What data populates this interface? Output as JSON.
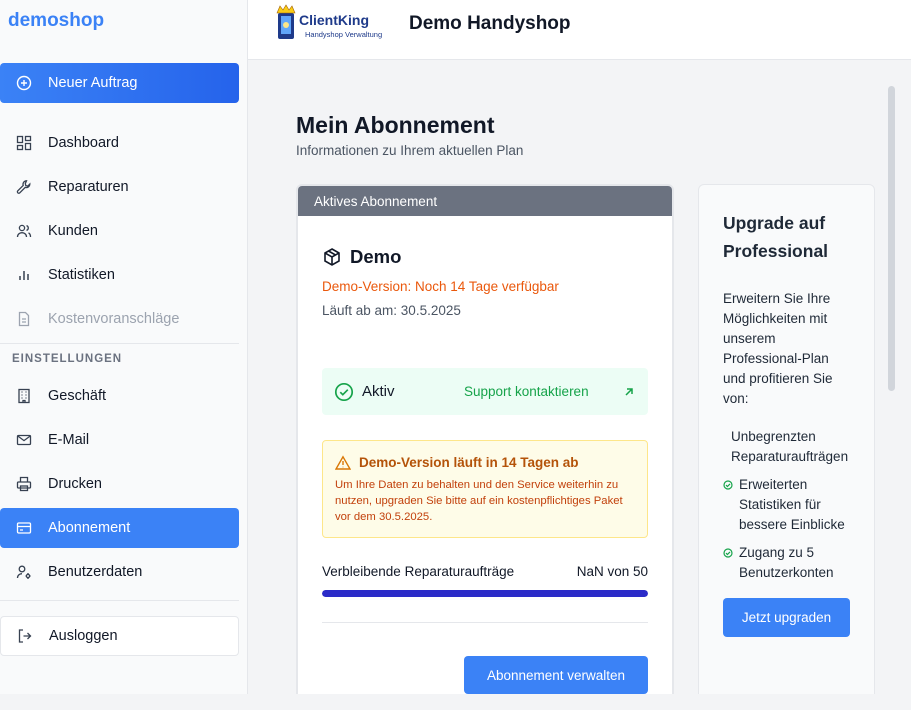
{
  "sidebar": {
    "brand": "demoshop",
    "new_order": "Neuer Auftrag",
    "items": [
      {
        "label": "Dashboard",
        "icon": "dashboard-icon"
      },
      {
        "label": "Reparaturen",
        "icon": "wrench-icon"
      },
      {
        "label": "Kunden",
        "icon": "users-icon"
      },
      {
        "label": "Statistiken",
        "icon": "bar-chart-icon"
      },
      {
        "label": "Kostenvoranschläge",
        "icon": "document-icon"
      }
    ],
    "settings_label": "EINSTELLUNGEN",
    "settings_items": [
      {
        "label": "Geschäft",
        "icon": "building-icon"
      },
      {
        "label": "E-Mail",
        "icon": "mail-icon"
      },
      {
        "label": "Drucken",
        "icon": "printer-icon"
      },
      {
        "label": "Abonnement",
        "icon": "credit-card-icon"
      },
      {
        "label": "Benutzerdaten",
        "icon": "user-settings-icon"
      }
    ],
    "logout": "Ausloggen"
  },
  "header": {
    "logo_text": "ClientKing",
    "logo_sub": "Handyshop Verwaltung",
    "title": "Demo Handyshop"
  },
  "main": {
    "title": "Mein Abonnement",
    "subtitle": "Informationen zu Ihrem aktuellen Plan",
    "card": {
      "header": "Aktives Abonnement",
      "plan": "Demo",
      "demo_note": "Demo-Version: Noch 14 Tage verfügbar",
      "expires": "Läuft ab am: 30.5.2025",
      "status": "Aktiv",
      "support_link": "Support  kontaktieren",
      "warning_title": "Demo-Version läuft in 14 Tagen ab",
      "warning_text": "Um Ihre Daten zu behalten und den Service weiterhin zu nutzen, upgraden Sie bitte auf ein kostenpflichtiges Paket vor dem 30.5.2025.",
      "remaining_label": "Verbleibende Reparaturaufträge",
      "remaining_value": "NaN von 50",
      "progress_fraction": 1.0,
      "manage_button": "Abonnement verwalten"
    },
    "upgrade": {
      "title": "Upgrade auf Professional",
      "text": "Erweitern Sie Ihre Möglichkeiten mit unserem Professional-Plan und profitieren Sie von:",
      "features": [
        "Unbegrenzten Reparaturaufträgen",
        "Erweiterten Statistiken für bessere Einblicke",
        "Zugang zu 5 Benutzerkonten"
      ],
      "button": "Jetzt upgraden"
    }
  },
  "colors": {
    "accent": "#3b82f6",
    "success": "#16a34a",
    "warning": "#d97706",
    "orange_text": "#ea580c",
    "progress": "#2b2bc8"
  }
}
